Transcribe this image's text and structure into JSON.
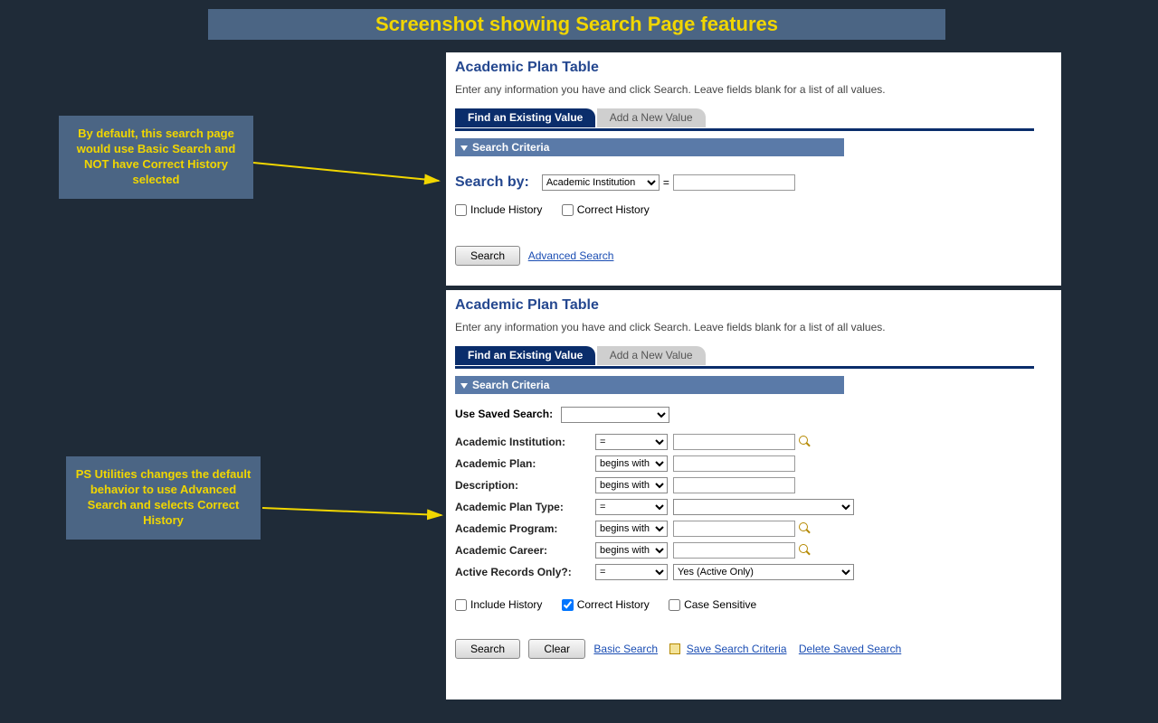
{
  "title": "Screenshot showing Search Page features",
  "callout1": "By default, this search page would use Basic Search and NOT have Correct History selected",
  "callout2": "PS Utilities changes the default behavior to use Advanced Search and selects Correct History",
  "panel": {
    "heading": "Academic Plan Table",
    "instructions": "Enter any information you have and click Search. Leave fields blank for a list of all values.",
    "tab_active": "Find an Existing Value",
    "tab_inactive": "Add a New Value",
    "criteria_header": "Search Criteria"
  },
  "basic": {
    "search_by_label": "Search by:",
    "search_by_value": "Academic Institution",
    "include_history": "Include History",
    "correct_history": "Correct History",
    "search_btn": "Search",
    "advanced_link": "Advanced Search"
  },
  "adv": {
    "use_saved_label": "Use Saved Search:",
    "fields": [
      {
        "label": "Academic Institution:",
        "op": "=",
        "value": "",
        "lookup": true,
        "wide": false
      },
      {
        "label": "Academic Plan:",
        "op": "begins with",
        "value": "",
        "lookup": false,
        "wide": false
      },
      {
        "label": "Description:",
        "op": "begins with",
        "value": "",
        "lookup": false,
        "wide": false
      },
      {
        "label": "Academic Plan Type:",
        "op": "=",
        "value": "",
        "lookup": false,
        "wide": true
      },
      {
        "label": "Academic Program:",
        "op": "begins with",
        "value": "",
        "lookup": true,
        "wide": false
      },
      {
        "label": "Academic Career:",
        "op": "begins with",
        "value": "",
        "lookup": true,
        "wide": false
      },
      {
        "label": "Active Records Only?:",
        "op": "=",
        "value": "Yes (Active Only)",
        "lookup": false,
        "wide": true
      }
    ],
    "include_history": "Include History",
    "correct_history": "Correct History",
    "case_sensitive": "Case Sensitive",
    "search_btn": "Search",
    "clear_btn": "Clear",
    "basic_link": "Basic Search",
    "save_link": "Save Search Criteria",
    "delete_link": "Delete Saved Search"
  }
}
